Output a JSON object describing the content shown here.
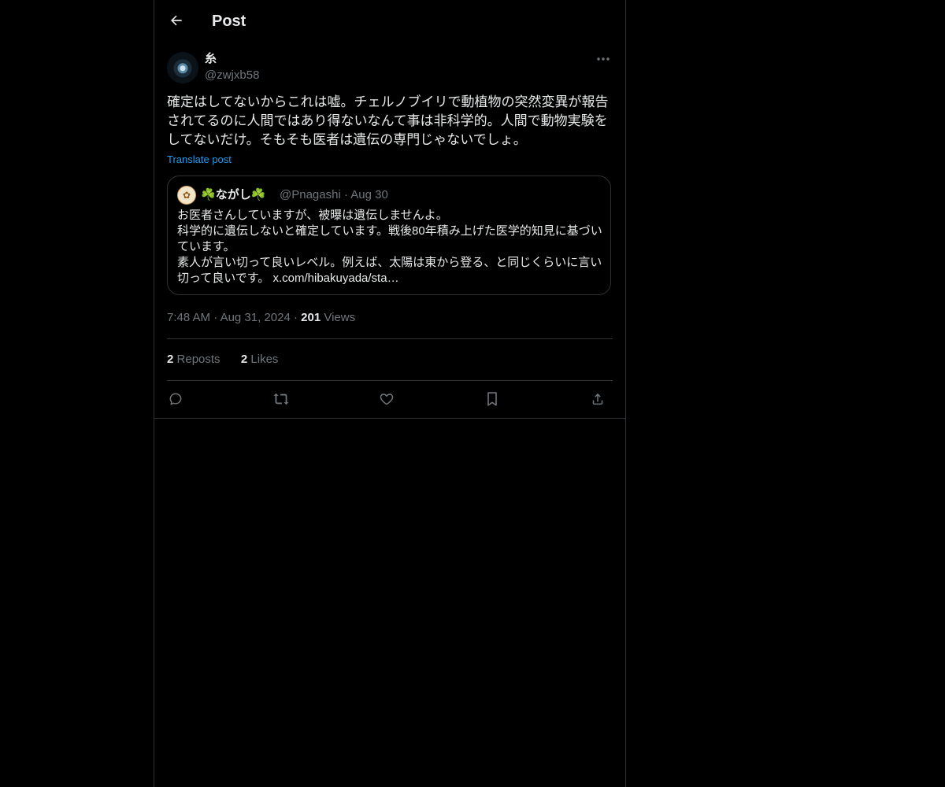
{
  "header": {
    "title": "Post"
  },
  "post": {
    "author_name": "糸",
    "author_handle": "@zwjxb58",
    "text": "確定はしてないからこれは嘘。チェルノブイリで動植物の突然変異が報告されてるのに人間ではあり得ないなんて事は非科学的。人間で動物実験をしてないだけ。そもそも医者は遺伝の専門じゃないでしょ。",
    "translate_label": "Translate post",
    "time": "7:48 AM",
    "date": "Aug 31, 2024",
    "views_count": "201",
    "views_label": "Views",
    "reposts_count": "2",
    "reposts_label": "Reposts",
    "likes_count": "2",
    "likes_label": "Likes"
  },
  "quote": {
    "name_prefix": "☘️",
    "name": "ながし",
    "name_suffix": "☘️",
    "handle": "@Pnagashi",
    "date": "Aug 30",
    "line1": "お医者さんしていますが、被曝は遺伝しませんよ。",
    "line2": "科学的に遺伝しないと確定しています。戦後80年積み上げた医学的知見に基づいています。",
    "line3": "素人が言い切って良いレベル。例えば、太陽は東から登る、と同じくらいに言い切って良いです。",
    "link": "x.com/hibakuyada/sta…"
  },
  "icons": {
    "back": "arrow-left-icon",
    "more": "more-horizontal-icon",
    "reply": "reply-icon",
    "repost": "repost-icon",
    "like": "heart-icon",
    "bookmark": "bookmark-icon",
    "share": "share-icon"
  },
  "colors": {
    "accent": "#1d9bf0",
    "muted": "#71767b",
    "border": "#2f3336"
  }
}
